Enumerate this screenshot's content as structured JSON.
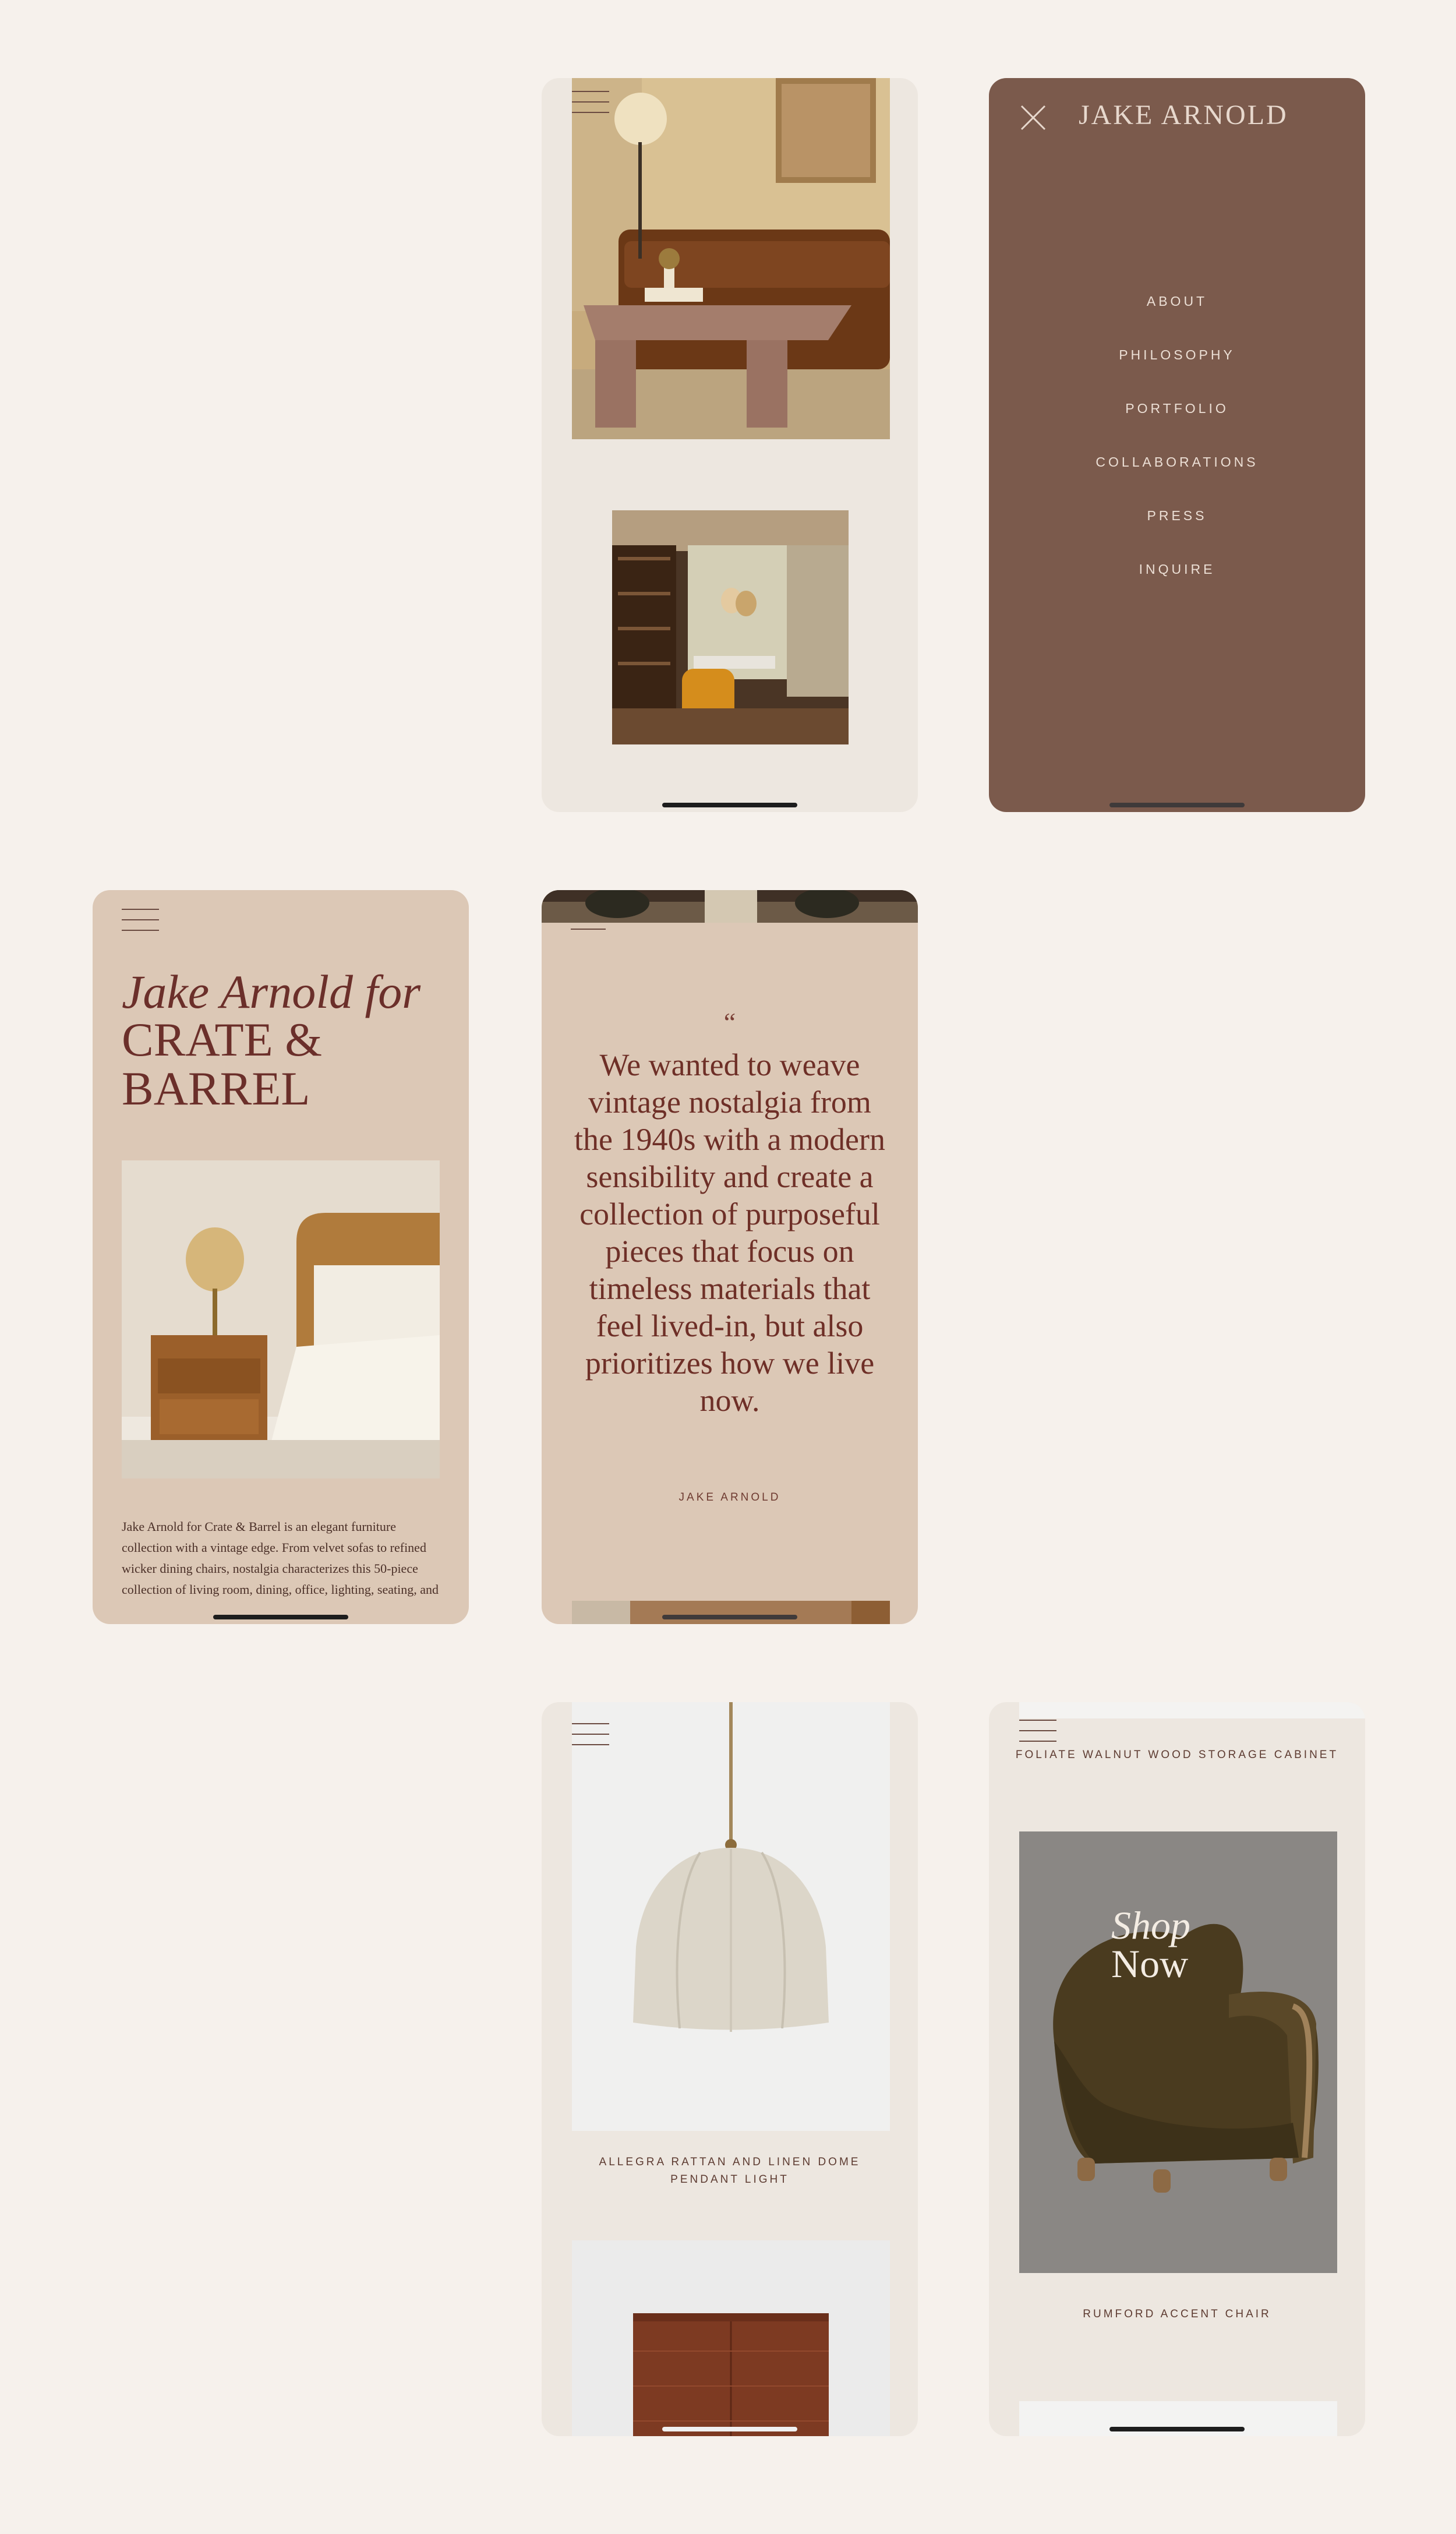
{
  "menu": {
    "brand": "JAKE ARNOLD",
    "items": [
      "ABOUT",
      "PHILOSOPHY",
      "PORTFOLIO",
      "COLLABORATIONS",
      "PRESS",
      "INQUIRE"
    ]
  },
  "title_screen": {
    "title_italic": "Jake Arnold for",
    "title_caps": "CRATE & BARREL",
    "intro": "Jake Arnold for Crate & Barrel is an elegant furniture collection with a vintage edge. From velvet sofas to refined wicker dining chairs, nostalgia characterizes this 50-piece collection of living room, dining, office, lighting, seating, and"
  },
  "quote_screen": {
    "mark": "“",
    "quote": "We wanted to weave vintage nostalgia from the 1940s with a modern sensibility and create a collection of purposeful pieces that focus on timeless materials that feel lived-in, but also prioritizes how we live now.",
    "author": "JAKE ARNOLD"
  },
  "products": {
    "pendant_caption": "ALLEGRA RATTAN AND LINEN DOME PENDANT LIGHT",
    "cabinet_caption": "FOLIATE WALNUT WOOD STORAGE CABINET",
    "chair_caption": "RUMFORD ACCENT CHAIR",
    "shop_line1": "Shop",
    "shop_line2": "Now"
  },
  "colors": {
    "page_bg": "#f6f1ec",
    "menu_bg": "#7b5a4c",
    "tan_bg": "#dcc8b6",
    "cream_bg": "#ede7e0",
    "accent_text": "#6b2f2a"
  },
  "icons": [
    "hamburger-menu-icon",
    "close-icon"
  ]
}
